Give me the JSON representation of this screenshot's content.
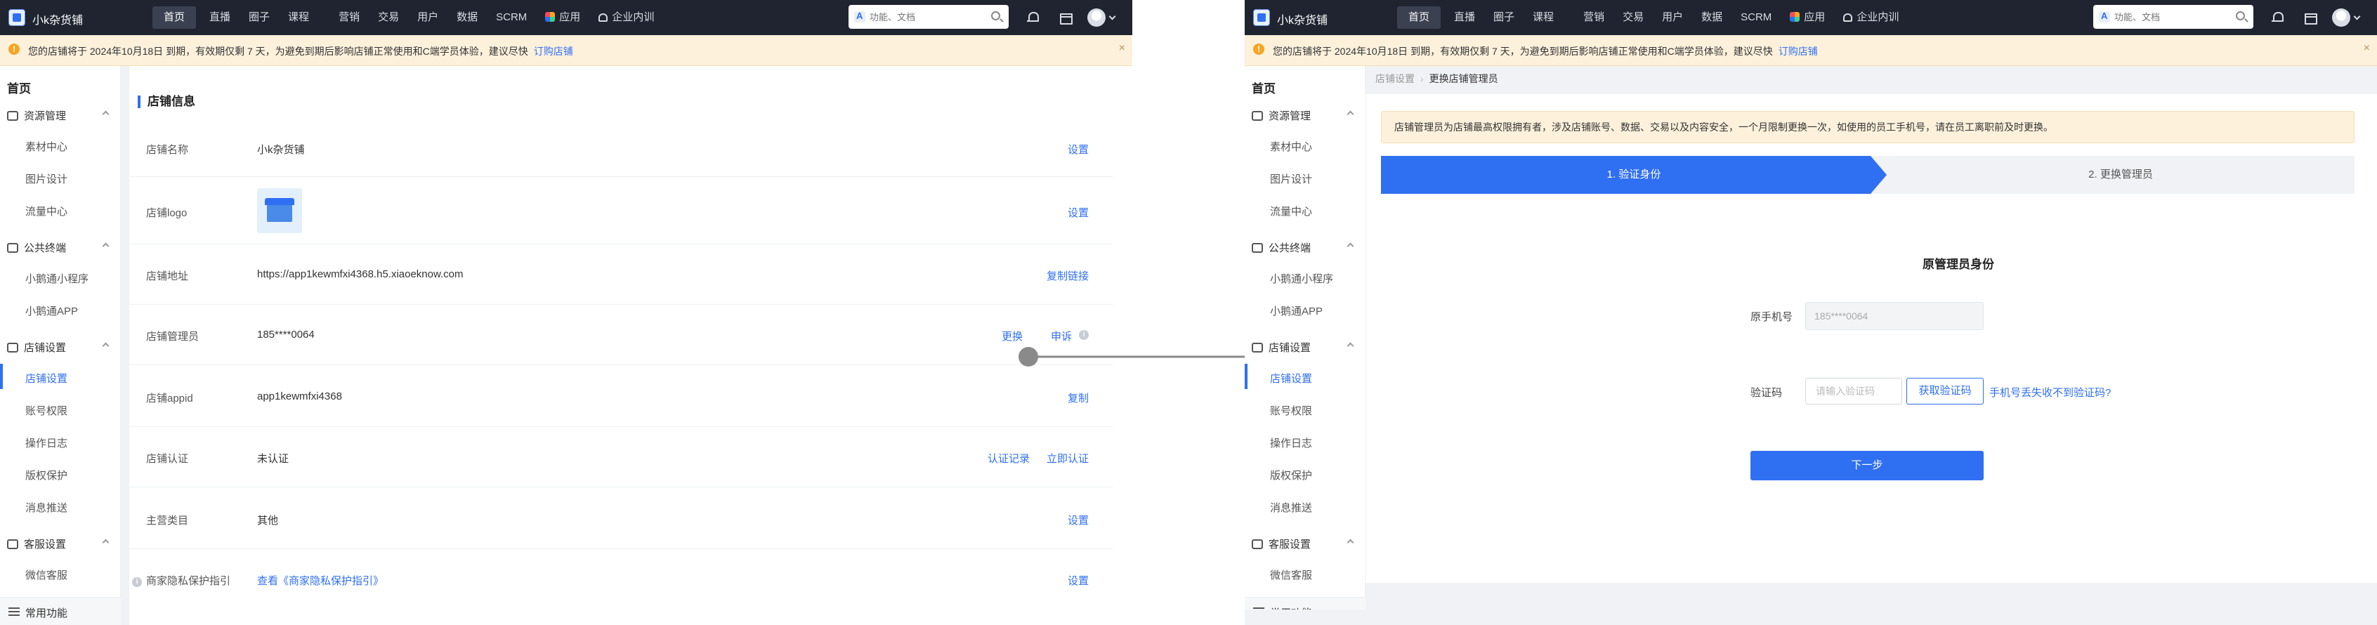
{
  "topbar": {
    "shop_name": "小k杂货铺",
    "nav": [
      "首页",
      "直播",
      "圈子",
      "课程",
      "营销",
      "交易",
      "用户",
      "数据",
      "SCRM",
      "应用",
      "企业内训"
    ],
    "search_placeholder": "功能、文档",
    "search_icon": "search-icon",
    "bell_icon": "bell-icon",
    "store_icon": "store-icon"
  },
  "notice": {
    "text": "您的店铺将于 2024年10月18日 到期，有效期仅剩 7 天，为避免到期后影响店铺正常使用和C端学员体验，建议尽快",
    "link": "订购店铺",
    "close_icon": "×"
  },
  "sidebar": {
    "home": "首页",
    "groups": [
      {
        "label": "资源管理",
        "items": [
          "素材中心",
          "图片设计",
          "流量中心"
        ]
      },
      {
        "label": "公共终端",
        "items": [
          "小鹅通小程序",
          "小鹅通APP"
        ]
      },
      {
        "label": "店铺设置",
        "items": [
          "店铺设置",
          "账号权限",
          "操作日志",
          "版权保护",
          "消息推送"
        ]
      },
      {
        "label": "客服设置",
        "items": [
          "微信客服"
        ]
      }
    ],
    "active_item": "店铺设置",
    "bottom": "常用功能"
  },
  "store_info": {
    "title": "店铺信息",
    "rows": [
      {
        "label": "店铺名称",
        "value": "小k杂货铺",
        "action": "设置"
      },
      {
        "label": "店铺logo",
        "value": "",
        "action": "设置"
      },
      {
        "label": "店铺地址",
        "value": "https://app1kewmfxi4368.h5.xiaoeknow.com",
        "action": "复制链接"
      },
      {
        "label": "店铺管理员",
        "value": "185****0064",
        "action": "更换",
        "action2": "申诉"
      },
      {
        "label": "店铺appid",
        "value": "app1kewmfxi4368",
        "action": "复制"
      },
      {
        "label": "店铺认证",
        "value": "未认证",
        "action": "认证记录",
        "action2": "立即认证"
      },
      {
        "label": "主营类目",
        "value": "其他",
        "action": "设置"
      },
      {
        "label": "商家隐私保护指引",
        "value": "查看《商家隐私保护指引》",
        "action": "设置"
      }
    ]
  },
  "change_admin": {
    "breadcrumb": [
      "店铺设置",
      "更换店铺管理员"
    ],
    "tip": "店铺管理员为店铺最高权限拥有者，涉及店铺账号、数据、交易以及内容安全，一个月限制更换一次，如使用的员工手机号，请在员工离职前及时更换。",
    "steps": [
      "1. 验证身份",
      "2. 更换管理员"
    ],
    "form_title": "原管理员身份",
    "phone_label": "原手机号",
    "phone_value": "185****0064",
    "code_label": "验证码",
    "code_placeholder": "请输入验证码",
    "get_code": "获取验证码",
    "lost_link": "手机号丢失收不到验证码?",
    "next": "下一步"
  }
}
